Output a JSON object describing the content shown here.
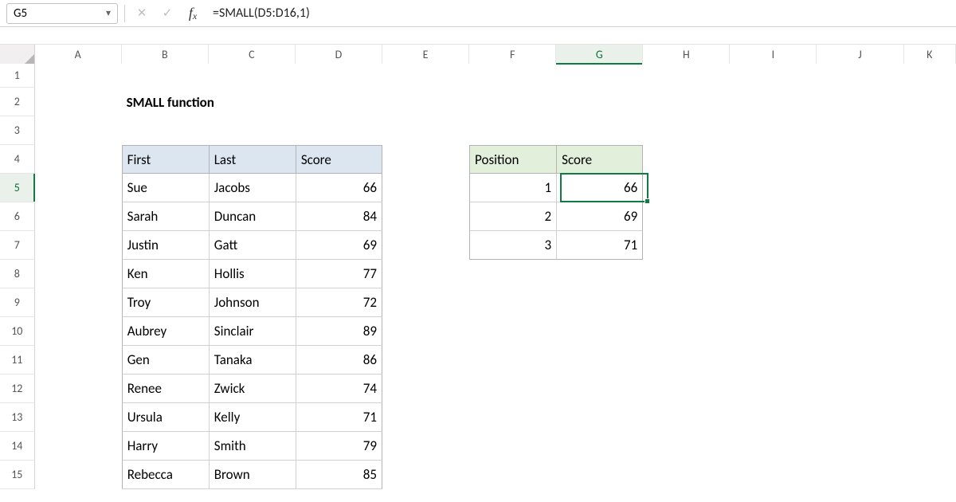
{
  "namebox": {
    "value": "G5"
  },
  "formula": "=SMALL(D5:D16,1)",
  "columns": [
    "A",
    "B",
    "C",
    "D",
    "E",
    "F",
    "G",
    "H",
    "I",
    "J",
    "K"
  ],
  "selected_col": "G",
  "selected_row": 5,
  "title": "SMALL function",
  "table1": {
    "headers": [
      "First",
      "Last",
      "Score"
    ],
    "rows": [
      {
        "first": "Sue",
        "last": "Jacobs",
        "score": 66
      },
      {
        "first": "Sarah",
        "last": "Duncan",
        "score": 84
      },
      {
        "first": "Justin",
        "last": "Gatt",
        "score": 69
      },
      {
        "first": "Ken",
        "last": "Hollis",
        "score": 77
      },
      {
        "first": "Troy",
        "last": "Johnson",
        "score": 72
      },
      {
        "first": "Aubrey",
        "last": "Sinclair",
        "score": 89
      },
      {
        "first": "Gen",
        "last": "Tanaka",
        "score": 86
      },
      {
        "first": "Renee",
        "last": "Zwick",
        "score": 74
      },
      {
        "first": "Ursula",
        "last": "Kelly",
        "score": 71
      },
      {
        "first": "Harry",
        "last": "Smith",
        "score": 79
      },
      {
        "first": "Rebecca",
        "last": "Brown",
        "score": 85
      }
    ]
  },
  "table2": {
    "headers": [
      "Position",
      "Score"
    ],
    "rows": [
      {
        "position": 1,
        "score": 66
      },
      {
        "position": 2,
        "score": 69
      },
      {
        "position": 3,
        "score": 71
      }
    ]
  },
  "active_cell": {
    "col": "G",
    "row": 5
  }
}
